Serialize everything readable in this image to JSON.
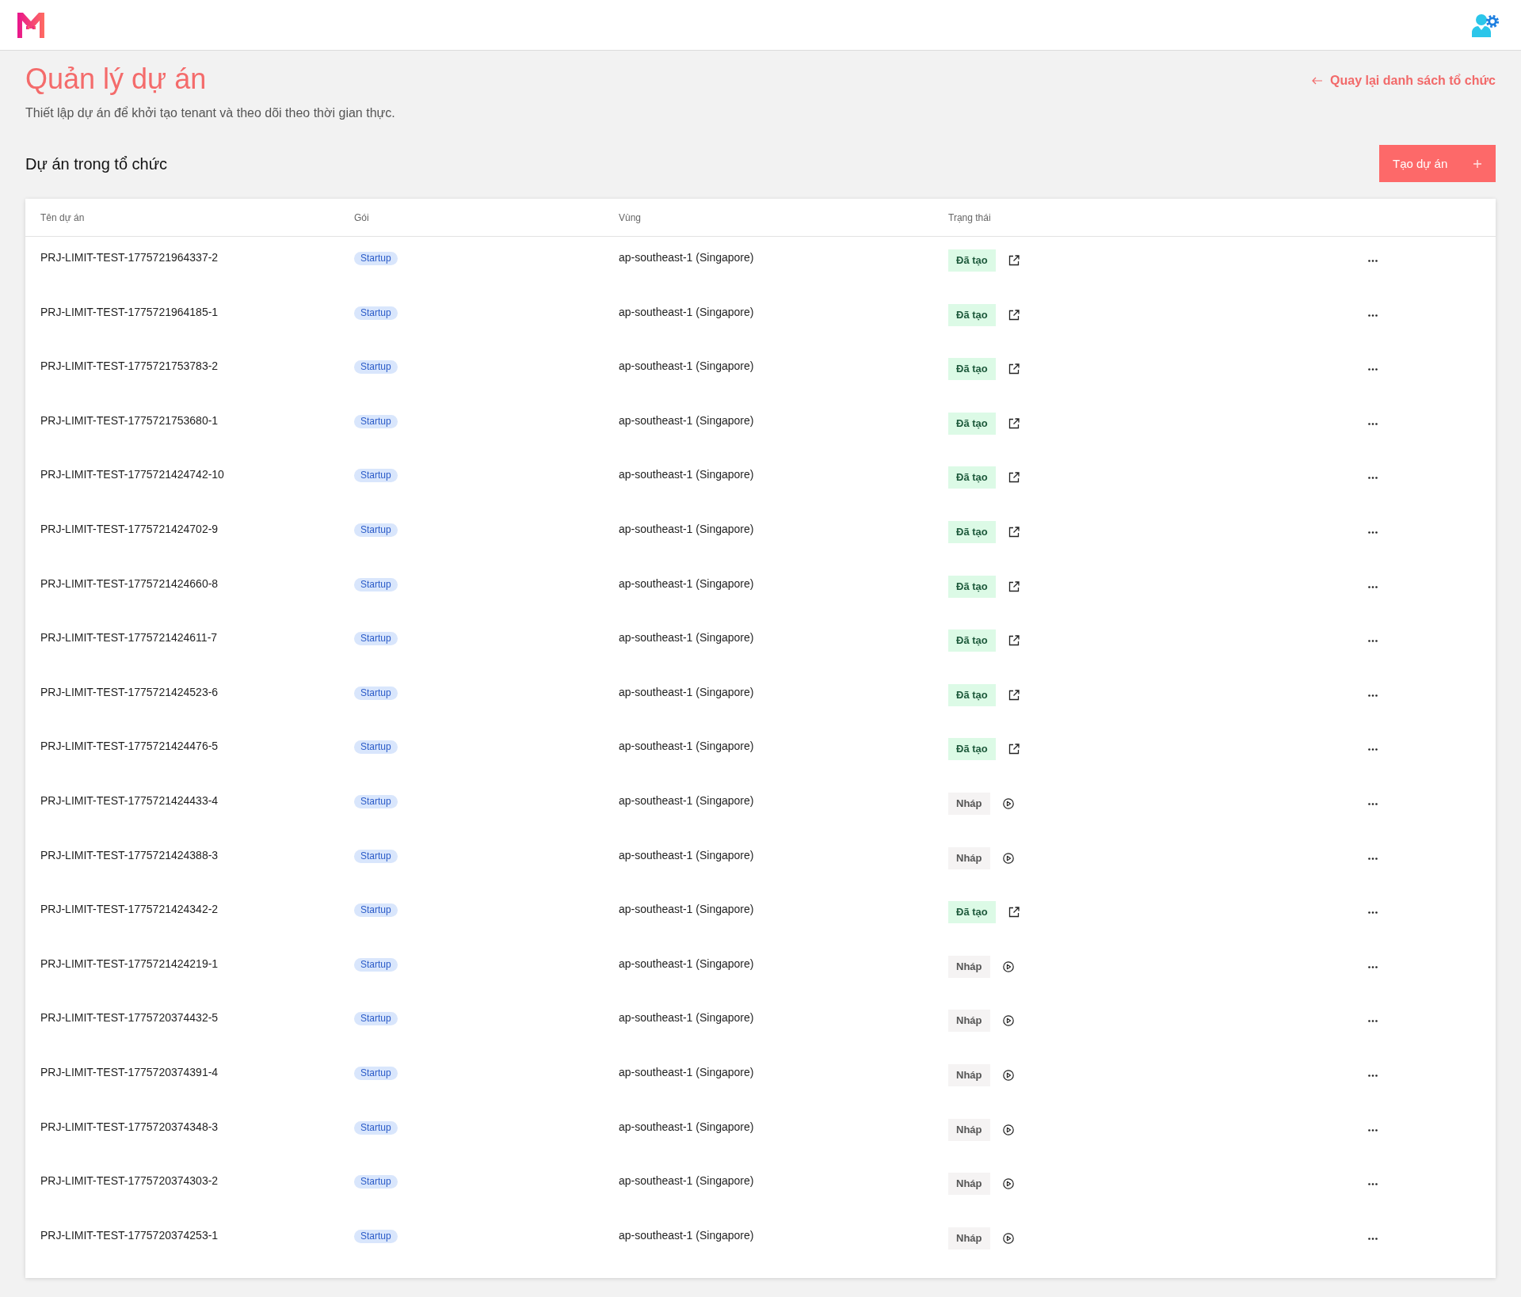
{
  "page": {
    "title": "Quản lý dự án",
    "subtitle": "Thiết lập dự án để khởi tạo tenant và theo dõi theo thời gian thực.",
    "back_link": "Quay lại danh sách tổ chức"
  },
  "section": {
    "title": "Dự án trong tổ chức",
    "create_button": "Tạo dự án"
  },
  "table": {
    "columns": [
      "Tên dự án",
      "Gói",
      "Vùng",
      "Trạng thái"
    ],
    "rows": [
      {
        "name": "PRJ-LIMIT-TEST-1775721964337-2",
        "plan": "Startup",
        "region": "ap-southeast-1 (Singapore)",
        "status": {
          "label": "Đã tạo",
          "kind": "created"
        }
      },
      {
        "name": "PRJ-LIMIT-TEST-1775721964185-1",
        "plan": "Startup",
        "region": "ap-southeast-1 (Singapore)",
        "status": {
          "label": "Đã tạo",
          "kind": "created"
        }
      },
      {
        "name": "PRJ-LIMIT-TEST-1775721753783-2",
        "plan": "Startup",
        "region": "ap-southeast-1 (Singapore)",
        "status": {
          "label": "Đã tạo",
          "kind": "created"
        }
      },
      {
        "name": "PRJ-LIMIT-TEST-1775721753680-1",
        "plan": "Startup",
        "region": "ap-southeast-1 (Singapore)",
        "status": {
          "label": "Đã tạo",
          "kind": "created"
        }
      },
      {
        "name": "PRJ-LIMIT-TEST-1775721424742-10",
        "plan": "Startup",
        "region": "ap-southeast-1 (Singapore)",
        "status": {
          "label": "Đã tạo",
          "kind": "created"
        }
      },
      {
        "name": "PRJ-LIMIT-TEST-1775721424702-9",
        "plan": "Startup",
        "region": "ap-southeast-1 (Singapore)",
        "status": {
          "label": "Đã tạo",
          "kind": "created"
        }
      },
      {
        "name": "PRJ-LIMIT-TEST-1775721424660-8",
        "plan": "Startup",
        "region": "ap-southeast-1 (Singapore)",
        "status": {
          "label": "Đã tạo",
          "kind": "created"
        }
      },
      {
        "name": "PRJ-LIMIT-TEST-1775721424611-7",
        "plan": "Startup",
        "region": "ap-southeast-1 (Singapore)",
        "status": {
          "label": "Đã tạo",
          "kind": "created"
        }
      },
      {
        "name": "PRJ-LIMIT-TEST-1775721424523-6",
        "plan": "Startup",
        "region": "ap-southeast-1 (Singapore)",
        "status": {
          "label": "Đã tạo",
          "kind": "created"
        }
      },
      {
        "name": "PRJ-LIMIT-TEST-1775721424476-5",
        "plan": "Startup",
        "region": "ap-southeast-1 (Singapore)",
        "status": {
          "label": "Đã tạo",
          "kind": "created"
        }
      },
      {
        "name": "PRJ-LIMIT-TEST-1775721424433-4",
        "plan": "Startup",
        "region": "ap-southeast-1 (Singapore)",
        "status": {
          "label": "Nháp",
          "kind": "draft"
        }
      },
      {
        "name": "PRJ-LIMIT-TEST-1775721424388-3",
        "plan": "Startup",
        "region": "ap-southeast-1 (Singapore)",
        "status": {
          "label": "Nháp",
          "kind": "draft"
        }
      },
      {
        "name": "PRJ-LIMIT-TEST-1775721424342-2",
        "plan": "Startup",
        "region": "ap-southeast-1 (Singapore)",
        "status": {
          "label": "Đã tạo",
          "kind": "created"
        }
      },
      {
        "name": "PRJ-LIMIT-TEST-1775721424219-1",
        "plan": "Startup",
        "region": "ap-southeast-1 (Singapore)",
        "status": {
          "label": "Nháp",
          "kind": "draft"
        }
      },
      {
        "name": "PRJ-LIMIT-TEST-1775720374432-5",
        "plan": "Startup",
        "region": "ap-southeast-1 (Singapore)",
        "status": {
          "label": "Nháp",
          "kind": "draft"
        }
      },
      {
        "name": "PRJ-LIMIT-TEST-1775720374391-4",
        "plan": "Startup",
        "region": "ap-southeast-1 (Singapore)",
        "status": {
          "label": "Nháp",
          "kind": "draft"
        }
      },
      {
        "name": "PRJ-LIMIT-TEST-1775720374348-3",
        "plan": "Startup",
        "region": "ap-southeast-1 (Singapore)",
        "status": {
          "label": "Nháp",
          "kind": "draft"
        }
      },
      {
        "name": "PRJ-LIMIT-TEST-1775720374303-2",
        "plan": "Startup",
        "region": "ap-southeast-1 (Singapore)",
        "status": {
          "label": "Nháp",
          "kind": "draft"
        }
      },
      {
        "name": "PRJ-LIMIT-TEST-1775720374253-1",
        "plan": "Startup",
        "region": "ap-southeast-1 (Singapore)",
        "status": {
          "label": "Nháp",
          "kind": "draft"
        }
      }
    ]
  }
}
